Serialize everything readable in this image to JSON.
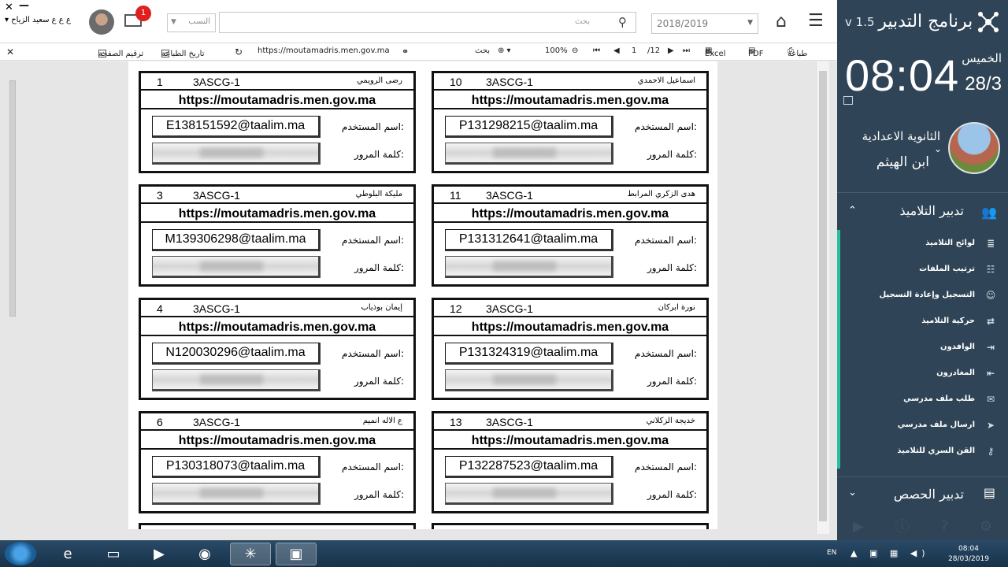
{
  "sidebar": {
    "app_title": "برنامج التدبير",
    "version": "v 1.5",
    "time": "08:04",
    "day": "الخميس",
    "date": "28/3",
    "school_line1": "الثانوية الاعدادية",
    "school_line2": "ابن الهيثم",
    "section_title": "تدبير التلاميذ",
    "menu": [
      {
        "label": "لوائح التلاميذ",
        "icon": "list-icon"
      },
      {
        "label": "ترتيب الملفات",
        "icon": "sort-icon"
      },
      {
        "label": "التسجيل وإعادة التسجيل",
        "icon": "person-icon"
      },
      {
        "label": "حركية التلاميذ",
        "icon": "move-icon"
      },
      {
        "label": "الوافدون",
        "icon": "enter-icon"
      },
      {
        "label": "المغادرون",
        "icon": "exit-icon"
      },
      {
        "label": "طلب ملف مدرسي",
        "icon": "request-icon"
      },
      {
        "label": "ارسال ملف مدرسي",
        "icon": "send-icon"
      },
      {
        "label": "القن السري للتلاميذ",
        "icon": "key-icon"
      }
    ],
    "bottom_section_title": "تدبير الحصص"
  },
  "topbar": {
    "user_name": "ع ع ع سعيد الزياح",
    "mail_badge": "1",
    "combo_placeholder": "النسب",
    "search_placeholder": "بحث",
    "year": "2018/2019"
  },
  "report_toolbar": {
    "page_numbering": "ترقيم الصفحة",
    "print_date": "تاريخ الطباعة",
    "url": "https://moutamadris.men.gov.ma",
    "search": "بحث",
    "zoom": "100%",
    "page": "1",
    "total_pages": "/12",
    "excel": "Excel",
    "pdf": "PDF",
    "print": "طباعة"
  },
  "card_labels": {
    "url": "https://moutamadris.men.gov.ma",
    "username_label": "اسم المستخدم:",
    "password_label": "كلمة المرور:"
  },
  "cards": [
    {
      "num": "1",
      "class": "3ASCG-1",
      "name": "رضى الرويمي",
      "user": "E138151592@taalim.ma"
    },
    {
      "num": "10",
      "class": "3ASCG-1",
      "name": "اسماعيل الاحمدي",
      "user": "P131298215@taalim.ma"
    },
    {
      "num": "3",
      "class": "3ASCG-1",
      "name": "مليكة البلوطي",
      "user": "M139306298@taalim.ma"
    },
    {
      "num": "11",
      "class": "3ASCG-1",
      "name": "هدى الزكري المرابط",
      "user": "P131312641@taalim.ma"
    },
    {
      "num": "4",
      "class": "3ASCG-1",
      "name": "إيمان بوذياب",
      "user": "N120030296@taalim.ma"
    },
    {
      "num": "12",
      "class": "3ASCG-1",
      "name": "نورة ابركان",
      "user": "P131324319@taalim.ma"
    },
    {
      "num": "6",
      "class": "3ASCG-1",
      "name": "ع الاله انميم",
      "user": "P130318073@taalim.ma"
    },
    {
      "num": "13",
      "class": "3ASCG-1",
      "name": "خديجة الزكلاني",
      "user": "P132287523@taalim.ma"
    }
  ],
  "taskbar": {
    "lang": "EN",
    "time": "08:04",
    "date": "28/03/2019"
  }
}
